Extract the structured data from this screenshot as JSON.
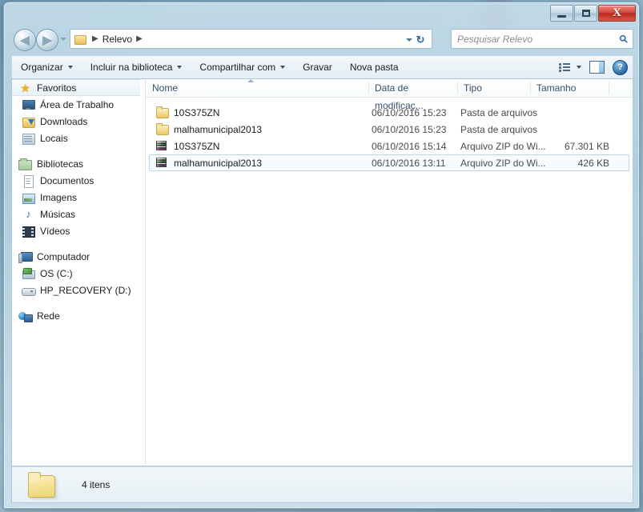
{
  "window": {
    "controls": {
      "minimize_label": "–",
      "maximize_label": "□",
      "close_label": "X"
    }
  },
  "address_bar": {
    "back_label": "◀",
    "forward_label": "▶",
    "path_label": "Relevo",
    "separator": "▶",
    "refresh_label": "↻"
  },
  "search": {
    "placeholder": "Pesquisar Relevo",
    "icon": "search-icon",
    "glyph": "⚲"
  },
  "toolbar": {
    "items": [
      {
        "label": "Organizar",
        "has_caret": true
      },
      {
        "label": "Incluir na biblioteca",
        "has_caret": true
      },
      {
        "label": "Compartilhar com",
        "has_caret": true
      },
      {
        "label": "Gravar",
        "has_caret": false
      },
      {
        "label": "Nova pasta",
        "has_caret": false
      }
    ],
    "help_label": "?"
  },
  "sidebar": {
    "groups": [
      {
        "root": {
          "label": "Favoritos",
          "icon": "star-icon",
          "selected": true
        },
        "items": [
          {
            "label": "Área de Trabalho",
            "icon": "desktop-icon"
          },
          {
            "label": "Downloads",
            "icon": "downloads-folder-icon"
          },
          {
            "label": "Locais",
            "icon": "recent-places-icon"
          }
        ]
      },
      {
        "root": {
          "label": "Bibliotecas",
          "icon": "libraries-icon",
          "selected": false
        },
        "items": [
          {
            "label": "Documentos",
            "icon": "documents-icon"
          },
          {
            "label": "Imagens",
            "icon": "pictures-icon"
          },
          {
            "label": "Músicas",
            "icon": "music-icon"
          },
          {
            "label": "Vídeos",
            "icon": "videos-icon"
          }
        ]
      },
      {
        "root": {
          "label": "Computador",
          "icon": "computer-icon",
          "selected": false
        },
        "items": [
          {
            "label": "OS (C:)",
            "icon": "system-drive-icon"
          },
          {
            "label": "HP_RECOVERY (D:)",
            "icon": "hard-drive-icon"
          }
        ]
      },
      {
        "root": {
          "label": "Rede",
          "icon": "network-icon",
          "selected": false
        },
        "items": []
      }
    ]
  },
  "file_list": {
    "columns": [
      {
        "label": "Nome",
        "sorted": true,
        "sort_direction": "ascending"
      },
      {
        "label": "Data de modificaç...",
        "sorted": false
      },
      {
        "label": "Tipo",
        "sorted": false
      },
      {
        "label": "Tamanho",
        "sorted": false
      }
    ],
    "rows": [
      {
        "name": "10S375ZN",
        "date": "06/10/2016 15:23",
        "type": "Pasta de arquivos",
        "size": "",
        "icon": "folder-icon",
        "selected": false
      },
      {
        "name": "malhamunicipal2013",
        "date": "06/10/2016 15:23",
        "type": "Pasta de arquivos",
        "size": "",
        "icon": "folder-icon",
        "selected": false
      },
      {
        "name": "10S375ZN",
        "date": "06/10/2016 15:14",
        "type": "Arquivo ZIP do Wi...",
        "size": "67.301 KB",
        "icon": "zip-archive-icon",
        "selected": false
      },
      {
        "name": "malhamunicipal2013",
        "date": "06/10/2016 13:11",
        "type": "Arquivo ZIP do Wi...",
        "size": "426 KB",
        "icon": "zip-archive-icon",
        "selected": true
      }
    ]
  },
  "status_bar": {
    "item_count_label": "4 itens",
    "icon": "folder-icon"
  },
  "colors": {
    "accent": "#2a6ba8",
    "glass": "#bcd8e7",
    "selection": "#b6d7ef",
    "folder": "#f4dd93"
  }
}
